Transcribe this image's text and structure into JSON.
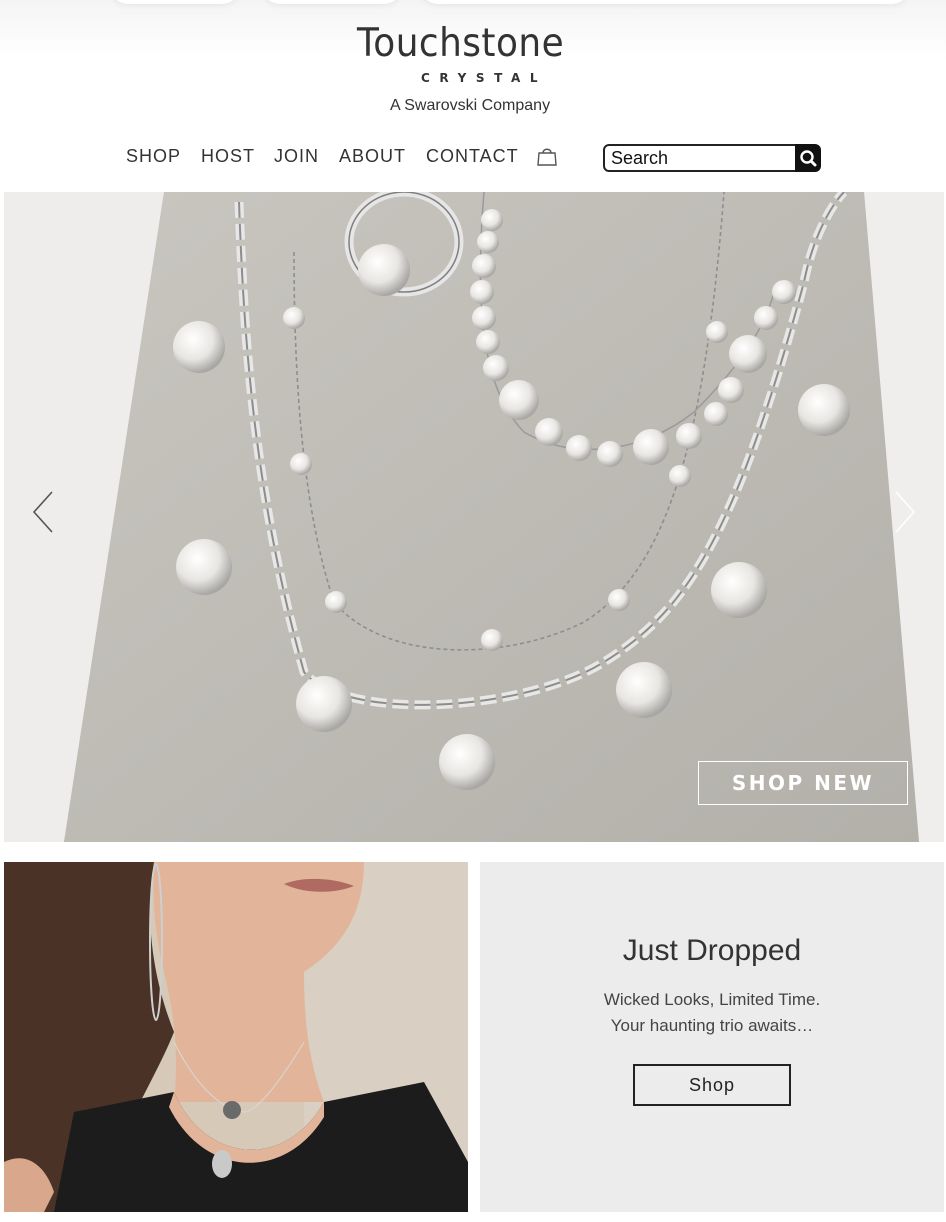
{
  "brand": {
    "name": "Touchstone",
    "subname": "CRYSTAL",
    "tagline": "A Swarovski Company"
  },
  "nav": {
    "items": [
      "SHOP",
      "HOST",
      "JOIN",
      "ABOUT",
      "CONTACT"
    ],
    "cart_icon": "shopping-bag-icon"
  },
  "search": {
    "placeholder": "Search",
    "icon": "search-icon"
  },
  "hero": {
    "cta_label": "SHOP NEW",
    "prev_icon": "chevron-left-icon",
    "next_icon": "chevron-right-icon"
  },
  "promo": {
    "title": "Just Dropped",
    "line1": "Wicked Looks, Limited Time.",
    "line2": "Your haunting trio awaits…",
    "button_label": "Shop"
  },
  "colors": {
    "text": "#333333",
    "panel": "#ececec",
    "button_border": "#222222"
  }
}
